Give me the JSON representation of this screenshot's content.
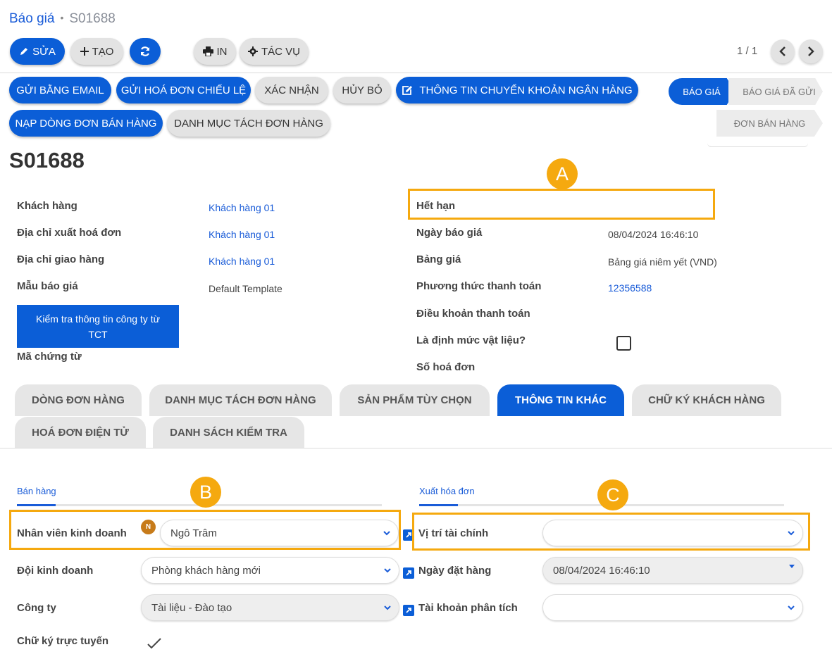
{
  "breadcrumb": {
    "parent": "Báo giá",
    "current": "S01688"
  },
  "toolbar": {
    "edit": "SỬA",
    "create": "TẠO",
    "print": "IN",
    "action": "TÁC VỤ",
    "pager": "1 / 1"
  },
  "actions": {
    "send_email": "GỬI BẰNG EMAIL",
    "send_proforma": "GỬI HOÁ ĐƠN CHIẾU LỆ",
    "confirm": "XÁC NHẬN",
    "cancel": "HỦY BỎ",
    "bank_info": "THÔNG TIN CHUYỂN KHOẢN NGÂN HÀNG",
    "load_lines": "NẠP DÒNG ĐƠN BÁN HÀNG",
    "split_list": "DANH MỤC TÁCH ĐƠN HÀNG"
  },
  "status": {
    "quotation": "BÁO GIÁ",
    "quotation_sent": "BÁO GIÁ ĐÃ GỬI",
    "sales_order": "ĐƠN BÁN HÀNG"
  },
  "record": {
    "title": "S01688"
  },
  "left_fields": {
    "customer_label": "Khách hàng",
    "customer": "Khách hàng 01",
    "invoice_addr_label": "Địa chỉ xuất hoá đơn",
    "invoice_addr": "Khách hàng 01",
    "delivery_addr_label": "Địa chỉ giao hàng",
    "delivery_addr": "Khách hàng 01",
    "template_label": "Mẫu báo giá",
    "template": "Default Template",
    "check_company": "Kiểm tra thông tin công ty từ TCT",
    "doc_code_label": "Mã chứng từ"
  },
  "right_fields": {
    "expiry_label": "Hết hạn",
    "quote_date_label": "Ngày báo giá",
    "quote_date": "08/04/2024 16:46:10",
    "pricelist_label": "Bảng giá",
    "pricelist": "Bảng giá niêm yết (VND)",
    "payment_method_label": "Phương thức thanh toán",
    "payment_method": "12356588",
    "payment_terms_label": "Điều khoản thanh toán",
    "bom_label": "Là định mức vật liệu?",
    "invoice_no_label": "Số hoá đơn"
  },
  "markers": {
    "a": "A",
    "b": "B",
    "c": "C"
  },
  "tabs": [
    "DÒNG ĐƠN HÀNG",
    "DANH MỤC TÁCH ĐƠN HÀNG",
    "SẢN PHẨM TÙY CHỌN",
    "THÔNG TIN KHÁC",
    "CHỮ KÝ KHÁCH HÀNG",
    "HOÁ ĐƠN ĐIỆN TỬ",
    "DANH SÁCH KIỂM TRA"
  ],
  "active_tab": "THÔNG TIN KHÁC",
  "sales": {
    "section": "Bán hàng",
    "salesperson_label": "Nhân viên kinh doanh",
    "salesperson_initial": "N",
    "salesperson": "Ngô Trâm",
    "team_label": "Đội kinh doanh",
    "team": "Phòng khách hàng mới",
    "company_label": "Công ty",
    "company": "Tài liệu - Đào tạo",
    "signature_label": "Chữ ký trực tuyến"
  },
  "invoicing": {
    "section": "Xuất hóa đơn",
    "fiscal_label": "Vị trí tài chính",
    "fiscal": "",
    "order_date_label": "Ngày đặt hàng",
    "order_date": "08/04/2024 16:46:10",
    "analytic_label": "Tài khoản phân tích",
    "analytic": ""
  },
  "colors": {
    "primary": "#0b5ed7",
    "highlight": "#f5a90f",
    "link": "#1a5cd8"
  },
  "icons": [
    "pencil-icon",
    "plus-icon",
    "refresh-icon",
    "printer-icon",
    "gear-icon",
    "chevron-left-icon",
    "chevron-right-icon",
    "edit-square-icon",
    "chevron-down-icon",
    "external-link-icon",
    "checkmark-icon"
  ]
}
